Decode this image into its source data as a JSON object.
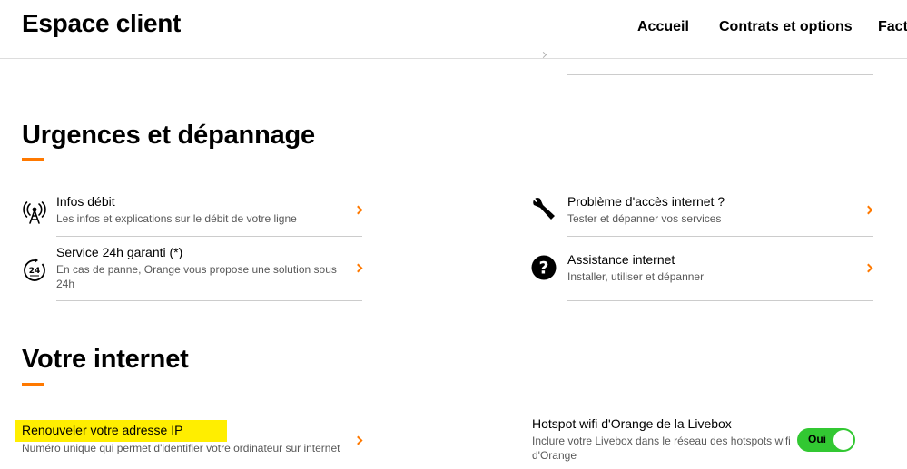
{
  "header": {
    "brand": "Espace client",
    "nav": [
      "Accueil",
      "Contrats et options",
      "Fact"
    ]
  },
  "colors": {
    "accent": "#ff7900",
    "toggle_on": "#32c832",
    "highlight": "#ffee00"
  },
  "urgences": {
    "title": "Urgences et dépannage",
    "items": [
      {
        "icon": "antenna-icon",
        "title": "Infos débit",
        "desc": "Les infos et explications sur le débit de votre ligne"
      },
      {
        "icon": "clock-24h-icon",
        "title": "Service 24h garanti (*)",
        "desc": "En cas de panne, Orange vous propose une solution sous 24h"
      },
      {
        "icon": "wrench-icon",
        "title": "Problème d'accès internet ?",
        "desc": "Tester et dépanner vos services"
      },
      {
        "icon": "help-circle-icon",
        "title": "Assistance internet",
        "desc": "Installer, utiliser et dépanner"
      }
    ]
  },
  "internet": {
    "title": "Votre internet",
    "renew_ip": {
      "title": "Renouveler votre adresse IP",
      "desc": "Numéro unique qui permet d'identifier votre ordinateur sur internet"
    },
    "hotspot": {
      "title": "Hotspot wifi d'Orange de la Livebox",
      "desc": "Inclure votre Livebox dans le réseau des hotspots wifi d'Orange",
      "toggle_label": "Oui",
      "enabled": true
    }
  }
}
